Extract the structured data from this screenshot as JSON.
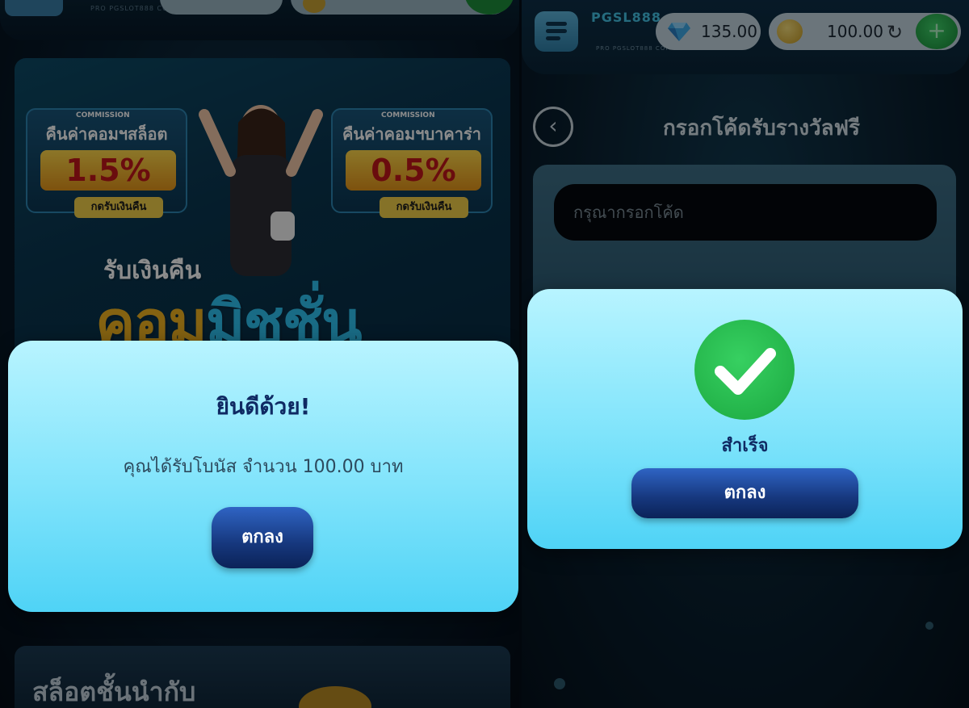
{
  "left_screen": {
    "header": {
      "logo_subtitle": "PRO PGSLOT888 COM"
    },
    "banner": {
      "left_card": {
        "commission_tag": "COMMISSION",
        "heading": "คืนค่าคอมฯสล็อต",
        "rate": "1.5%",
        "button": "กดรับเงินคืน"
      },
      "right_card": {
        "commission_tag": "COMMISSION",
        "heading": "คืนค่าคอมฯบาคาร่า",
        "rate": "0.5%",
        "button": "กดรับเงินคืน"
      },
      "headline_small": "รับเงินคืน",
      "headline_big_a": "คอม",
      "headline_big_b": "มิชชั่น"
    },
    "section_title": "สล็อตชั้นนำกับ",
    "modal": {
      "title": "ยินดีด้วย!",
      "message": "คุณได้รับโบนัส จำนวน 100.00 บาท",
      "ok_button": "ตกลง"
    }
  },
  "right_screen": {
    "header": {
      "logo_text": "PGSL888",
      "logo_subtitle": "PRO PGSLOT888 COM",
      "gem_balance": "135.00",
      "coin_balance": "100.00",
      "refresh_icon": "refresh-icon",
      "plus_label": "+"
    },
    "page_title": "กรอกโค้ดรับรางวัลฟรี",
    "code_input": {
      "placeholder": "กรุณากรอกโค้ด",
      "value": ""
    },
    "modal": {
      "status": "สำเร็จ",
      "ok_button": "ตกลง",
      "icon": "check-icon",
      "icon_color": "#1ba840"
    }
  },
  "colors": {
    "modal_top": "#b8f4ff",
    "modal_bottom": "#4fd3f6",
    "button": "#16377d",
    "title_text": "#0f2a63"
  }
}
